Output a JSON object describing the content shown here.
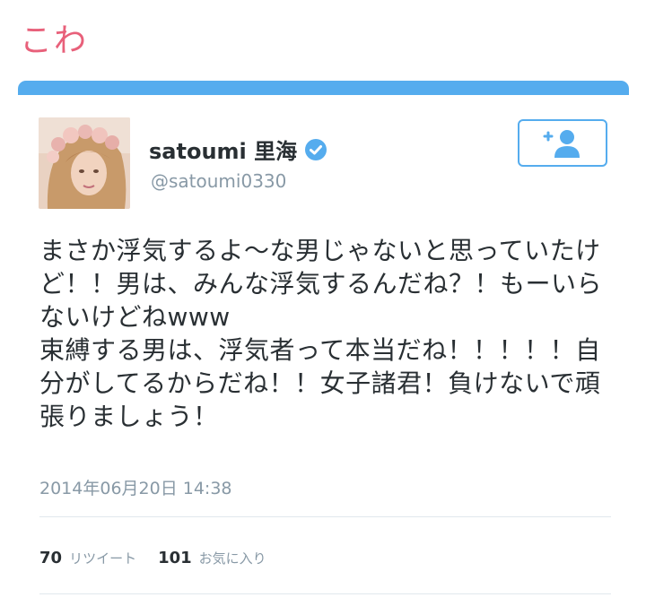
{
  "page": {
    "heading": "こわ"
  },
  "tweet": {
    "display_name": "satoumi 里海",
    "handle": "@satoumi0330",
    "text": "まさか浮気するよ〜な男じゃないと思っていたけど！！男は、みんな浮気するんだね？！もーいらないけどねwww\n束縛する男は、浮気者って本当だね！！！！！自分がしてるからだね！！女子諸君！負けないで頑張りましょう！",
    "timestamp": "2014年06月20日 14:38",
    "retweet_count": "70",
    "retweet_label": "リツイート",
    "favorite_count": "101",
    "favorite_label": "お気に入り"
  },
  "icons": {
    "verified": "verified-badge-icon",
    "follow": "add-user-icon"
  },
  "colors": {
    "heading": "#e8607a",
    "accent": "#55acee",
    "text": "#292f33",
    "muted": "#8899a6"
  }
}
